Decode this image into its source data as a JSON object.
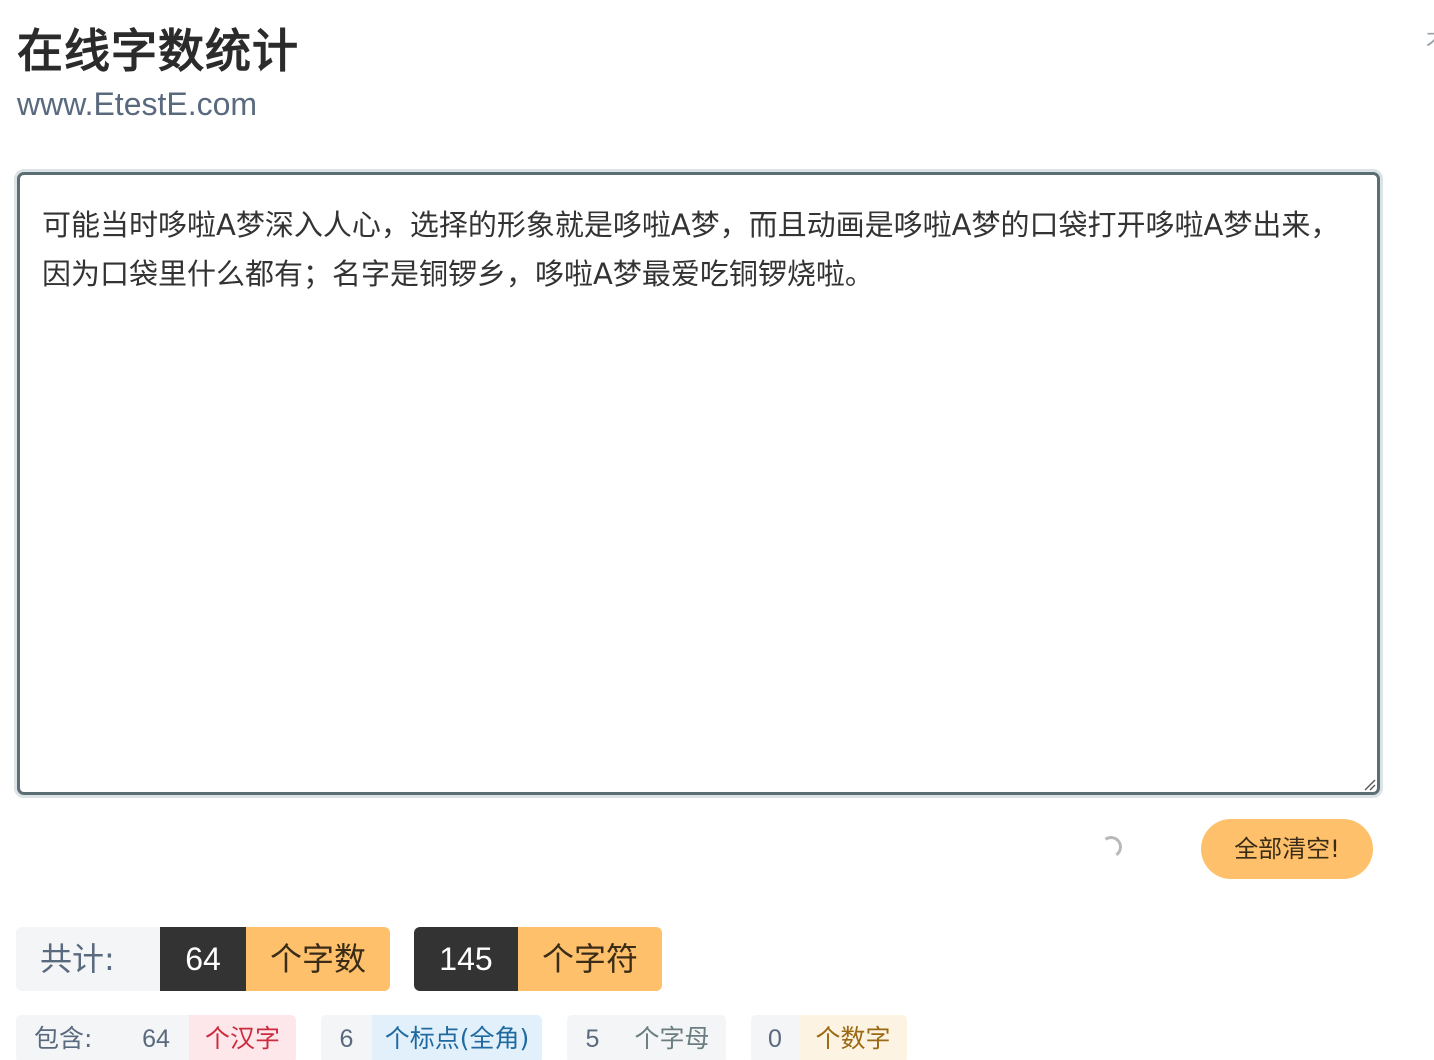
{
  "header": {
    "title": "在线字数统计",
    "subtitle": "www.EtestE.com",
    "corner_text": "才"
  },
  "editor": {
    "text": "可能当时哆啦A梦深入人心，选择的形象就是哆啦A梦，而且动画是哆啦A梦的口袋打开哆啦A梦出来，因为口袋里什么都有；名字是铜锣乡，哆啦A梦最爱吃铜锣烧啦。"
  },
  "actions": {
    "clear_label": "全部清空!"
  },
  "totals": {
    "label": "共计:",
    "word_count": "64",
    "word_unit": "个字数",
    "char_count": "145",
    "char_unit": "个字符"
  },
  "contains": {
    "label": "包含:",
    "hanzi_count": "64",
    "hanzi_unit": "个汉字",
    "punct_count": "6",
    "punct_unit": "个标点(全角)",
    "letter_count": "5",
    "letter_unit": "个字母",
    "digit_count": "0",
    "digit_unit": "个数字"
  },
  "colors": {
    "accent": "#ffc06b",
    "dark_badge": "#333333",
    "editor_border": "#5b6e73",
    "hanzi_text": "#cc2b3e",
    "punct_text": "#1f6aa0"
  }
}
